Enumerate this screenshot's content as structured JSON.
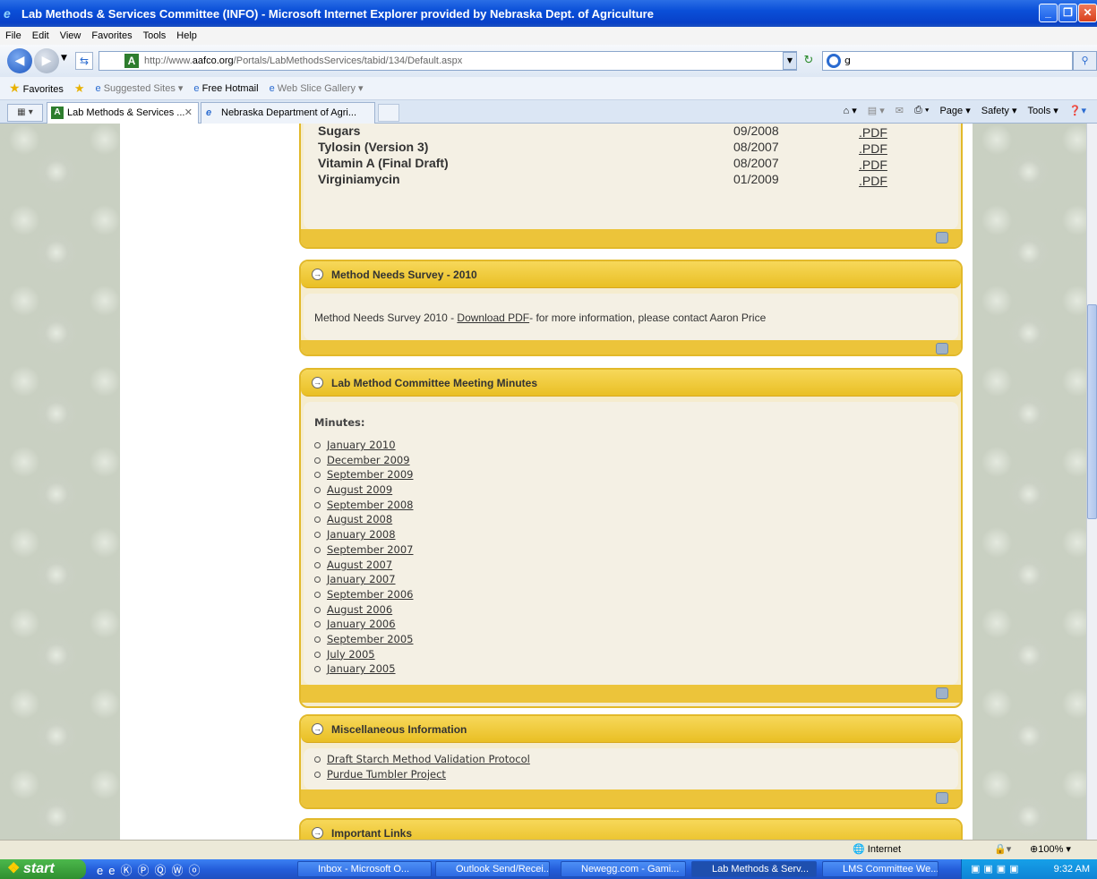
{
  "window": {
    "title": "Lab Methods & Services Committee (INFO) - Microsoft Internet Explorer provided by Nebraska Dept. of Agriculture"
  },
  "menubar": {
    "items": [
      "File",
      "Edit",
      "View",
      "Favorites",
      "Tools",
      "Help"
    ]
  },
  "address": {
    "url_prefix": "http://www.",
    "url_domain": "aafco.org",
    "url_path": "/Portals/LabMethodsServices/tabid/134/Default.aspx",
    "search_value": "g"
  },
  "favorites": {
    "label": "Favorites",
    "items": [
      "Suggested Sites ▾",
      "Free Hotmail",
      "Web Slice Gallery ▾"
    ]
  },
  "tabs": [
    {
      "label": "Lab Methods & Services ...",
      "active": true
    },
    {
      "label": "Nebraska Department of Agri...",
      "active": false
    }
  ],
  "commandbar": {
    "items": [
      "Page ▾",
      "Safety ▾",
      "Tools ▾"
    ]
  },
  "methods_table": {
    "rows": [
      {
        "name": "Sugars",
        "date": "09/2008",
        "link": ".PDF"
      },
      {
        "name": "Tylosin (Version 3)",
        "date": "08/2007",
        "link": ".PDF"
      },
      {
        "name": "Vitamin A (Final Draft)",
        "date": "08/2007",
        "link": ".PDF"
      },
      {
        "name": "Virginiamycin",
        "date": "01/2009",
        "link": ".PDF"
      }
    ]
  },
  "survey_panel": {
    "title": "Method Needs Survey - 2010",
    "text_before": "Method Needs Survey 2010 - ",
    "link": "Download PDF",
    "text_after": "- for more information, please contact Aaron Price"
  },
  "minutes_panel": {
    "title": "Lab Method Committee Meeting Minutes",
    "heading": "Minutes:",
    "items": [
      "January 2010",
      "December 2009",
      "September 2009",
      "August 2009",
      "September 2008",
      "August 2008",
      "January 2008",
      "September 2007",
      "August 2007",
      "January 2007",
      "September 2006",
      "August 2006",
      "January 2006",
      "September 2005",
      "July 2005",
      "January 2005"
    ]
  },
  "misc_panel": {
    "title": "Miscellaneous Information",
    "items": [
      "Draft Starch Method Validation Protocol",
      "Purdue Tumbler Project"
    ]
  },
  "links_panel": {
    "title": "Important Links"
  },
  "statusbar": {
    "zone": "Internet",
    "zoom": "100%"
  },
  "taskbar": {
    "start": "start",
    "tasks": [
      "Inbox - Microsoft O...",
      "Outlook Send/Recei...",
      "Newegg.com - Gami...",
      "Lab Methods & Serv...",
      "LMS Committee We..."
    ],
    "active_task": "Lab Methods & Serv...",
    "clock": "9:32 AM"
  }
}
